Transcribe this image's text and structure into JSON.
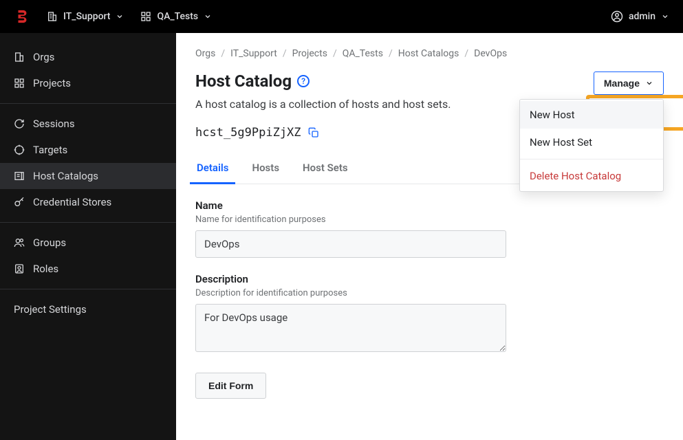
{
  "topbar": {
    "org_label": "IT_Support",
    "project_label": "QA_Tests",
    "user_label": "admin"
  },
  "sidebar": {
    "orgs": "Orgs",
    "projects": "Projects",
    "sessions": "Sessions",
    "targets": "Targets",
    "host_catalogs": "Host Catalogs",
    "credential_stores": "Credential Stores",
    "groups": "Groups",
    "roles": "Roles",
    "project_settings": "Project Settings"
  },
  "breadcrumb": {
    "orgs": "Orgs",
    "org": "IT_Support",
    "projects": "Projects",
    "project": "QA_Tests",
    "host_catalogs": "Host Catalogs",
    "current": "DevOps"
  },
  "page": {
    "title": "Host Catalog",
    "subtitle": "A host catalog is a collection of hosts and host sets.",
    "id": "hcst_5g9PpiZjXZ"
  },
  "manage": {
    "button": "Manage",
    "new_host": "New Host",
    "new_host_set": "New Host Set",
    "delete": "Delete Host Catalog"
  },
  "tabs": {
    "details": "Details",
    "hosts": "Hosts",
    "host_sets": "Host Sets"
  },
  "form": {
    "name_label": "Name",
    "name_help": "Name for identification purposes",
    "name_value": "DevOps",
    "desc_label": "Description",
    "desc_help": "Description for identification purposes",
    "desc_value": "For DevOps usage",
    "edit_button": "Edit Form"
  }
}
